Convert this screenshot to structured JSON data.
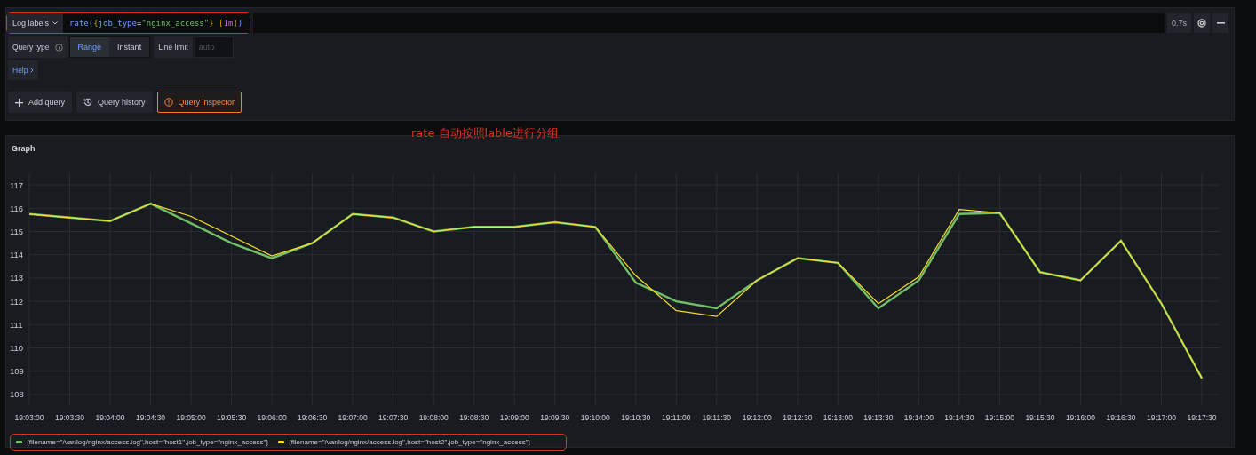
{
  "query_editor": {
    "labels_button": "Log labels",
    "query_tokens": [
      {
        "text": "rate(",
        "kind": "function"
      },
      {
        "text": "{",
        "kind": "brace"
      },
      {
        "text": "job_type",
        "kind": "label"
      },
      {
        "text": "=",
        "kind": "operator"
      },
      {
        "text": "\"nginx_access\"",
        "kind": "string"
      },
      {
        "text": "} ",
        "kind": "brace"
      },
      {
        "text": "[",
        "kind": "brace"
      },
      {
        "text": "1m",
        "kind": "range"
      },
      {
        "text": "]",
        "kind": "brace"
      },
      {
        "text": ")",
        "kind": "function"
      }
    ],
    "duration": "0.7s",
    "query_type_label": "Query type",
    "query_types": [
      {
        "label": "Range",
        "selected": true
      },
      {
        "label": "Instant",
        "selected": false
      }
    ],
    "line_limit_label": "Line limit",
    "line_limit_placeholder": "auto",
    "help": "Help",
    "actions": [
      {
        "label": "Add query",
        "selected": false
      },
      {
        "label": "Query history",
        "selected": false
      },
      {
        "label": "Query inspector",
        "selected": true
      }
    ]
  },
  "annotation": "rate 自动按照lable进行分组",
  "graph": {
    "title": "Graph",
    "chart_data": {
      "type": "line",
      "x": [
        "19:03:00",
        "19:03:30",
        "19:04:00",
        "19:04:30",
        "19:05:00",
        "19:05:30",
        "19:06:00",
        "19:06:30",
        "19:07:00",
        "19:07:30",
        "19:08:00",
        "19:08:30",
        "19:09:00",
        "19:09:30",
        "19:10:00",
        "19:10:30",
        "19:11:00",
        "19:11:30",
        "19:12:00",
        "19:12:30",
        "19:13:00",
        "19:13:30",
        "19:14:00",
        "19:14:30",
        "19:15:00",
        "19:15:30",
        "19:16:00",
        "19:16:30",
        "19:17:00",
        "19:17:30"
      ],
      "series": [
        {
          "name": "{filename=\"/var/log/nginx/access.log\",host=\"host1\",job_type=\"nginx_access\"}",
          "color": "#73bf69",
          "values": [
            115.75,
            115.6,
            115.45,
            116.2,
            115.35,
            114.5,
            113.85,
            114.5,
            115.75,
            115.6,
            115.0,
            115.2,
            115.2,
            115.4,
            115.2,
            112.8,
            112.0,
            111.7,
            112.9,
            113.85,
            113.65,
            111.7,
            112.9,
            115.75,
            115.8,
            113.25,
            112.9,
            114.6,
            111.9,
            108.7
          ]
        },
        {
          "name": "{filename=\"/var/log/nginx/access.log\",host=\"host2\",job_type=\"nginx_access\"}",
          "color": "#fade2a",
          "values": [
            115.75,
            115.6,
            115.45,
            116.2,
            115.65,
            114.8,
            113.95,
            114.5,
            115.75,
            115.6,
            115.0,
            115.2,
            115.2,
            115.4,
            115.2,
            113.1,
            111.6,
            111.35,
            112.9,
            113.85,
            113.65,
            111.9,
            113.05,
            115.95,
            115.8,
            113.25,
            112.9,
            114.6,
            111.9,
            108.7
          ]
        }
      ],
      "ylim": [
        107.5,
        117.5
      ],
      "yticks": [
        108,
        109,
        110,
        111,
        112,
        113,
        114,
        115,
        116,
        117
      ],
      "grid": true
    }
  }
}
